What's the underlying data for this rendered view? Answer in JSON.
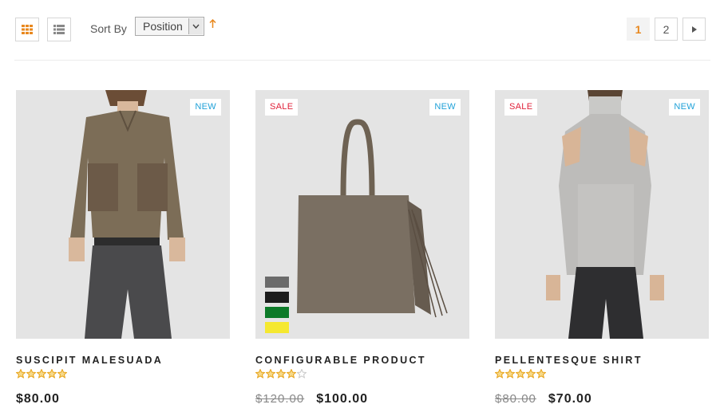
{
  "toolbar": {
    "grid_mode_icon": "grid-view-icon",
    "list_mode_icon": "list-view-icon",
    "sort_label": "Sort By",
    "sort_value": "Position",
    "sort_direction_icon": "arrow-up-icon",
    "pages": [
      "1",
      "2"
    ],
    "current_page": "1",
    "next_icon": "caret-right-icon"
  },
  "colors": {
    "accent": "#e8881e",
    "new_badge": "#1fa1d8",
    "sale_badge": "#e0213a",
    "star": "#e8a317"
  },
  "products": [
    {
      "name": "Suscipit Malesuada",
      "badges": {
        "new": "NEW",
        "sale": ""
      },
      "rating_stars": 5,
      "old_price": "",
      "price": "$80.00"
    },
    {
      "name": "Configurable Product",
      "badges": {
        "new": "NEW",
        "sale": "SALE"
      },
      "rating_stars": 4,
      "swatches": [
        "#6b6b6b",
        "#1c1c1c",
        "#0c7a28",
        "#f5e830"
      ],
      "old_price": "$120.00",
      "price": "$100.00"
    },
    {
      "name": "Pellentesque Shirt",
      "badges": {
        "new": "NEW",
        "sale": "SALE"
      },
      "rating_stars": 5,
      "old_price": "$80.00",
      "price": "$70.00"
    }
  ]
}
